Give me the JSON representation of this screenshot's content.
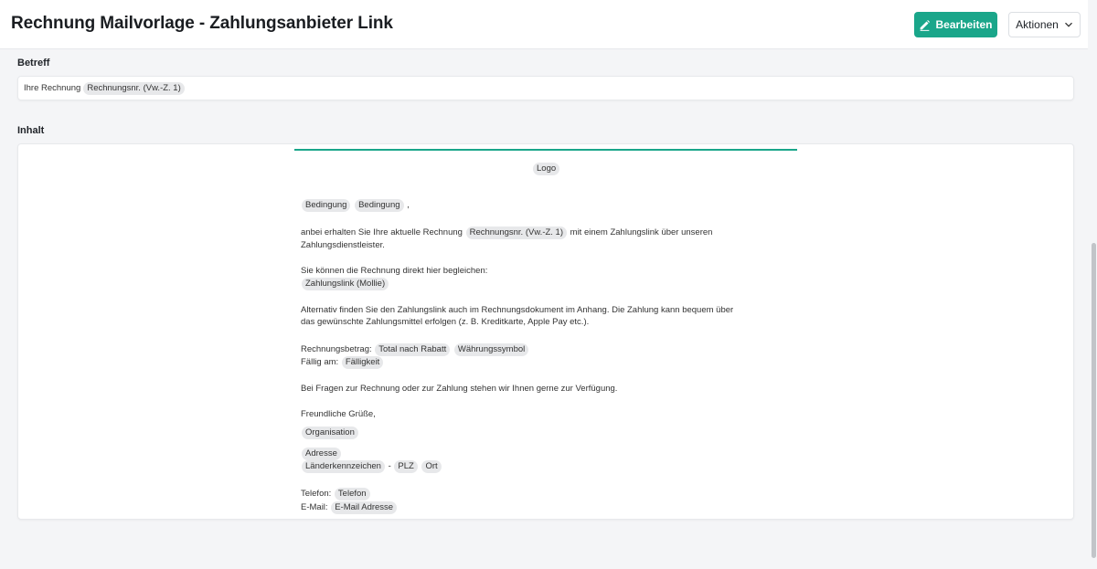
{
  "header": {
    "title": "Rechnung Mailvorlage - Zahlungsanbieter Link",
    "edit_label": "Bearbeiten",
    "actions_label": "Aktionen"
  },
  "subject": {
    "label": "Betreff",
    "prefix": "Ihre Rechnung",
    "tag": "Rechnungsnr. (Vw.-Z. 1)"
  },
  "content": {
    "label": "Inhalt",
    "logo_tag": "Logo",
    "greeting_tag1": "Bedingung",
    "greeting_tag2": "Bedingung",
    "greeting_suffix": ",",
    "intro_prefix": "anbei erhalten Sie Ihre aktuelle Rechnung",
    "intro_tag": "Rechnungsnr. (Vw.-Z. 1)",
    "intro_suffix": "mit einem Zahlungslink über unseren",
    "intro_line2": "Zahlungsdienstleister.",
    "pay_text": "Sie können die Rechnung direkt hier begleichen:",
    "pay_tag": "Zahlungslink (Mollie)",
    "alt_line1": "Alternativ finden Sie den Zahlungslink auch im Rechnungsdokument im Anhang. Die Zahlung kann bequem über",
    "alt_line2": "das gewünschte Zahlungsmittel erfolgen (z. B. Kreditkarte, Apple Pay etc.).",
    "amount_label": "Rechnungsbetrag:",
    "amount_tag1": "Total nach Rabatt",
    "amount_tag2": "Währungssymbol",
    "due_label": "Fällig am:",
    "due_tag": "Fälligkeit",
    "questions": "Bei Fragen zur Rechnung oder zur Zahlung stehen wir Ihnen gerne zur Verfügung.",
    "closing": "Freundliche Grüße,",
    "org_tag": "Organisation",
    "address_tag": "Adresse",
    "country_tag": "Länderkennzeichen",
    "dash": "-",
    "zip_tag": "PLZ",
    "city_tag": "Ort",
    "phone_label": "Telefon:",
    "phone_tag": "Telefon",
    "email_label": "E-Mail:",
    "email_tag": "E-Mail Adresse"
  },
  "colors": {
    "accent": "#1aa68a",
    "tag_bg": "#e7e8ea",
    "background": "#f4f5f7"
  },
  "icons": {
    "edit": "pencil-icon",
    "actions": "chevron-down-icon"
  }
}
